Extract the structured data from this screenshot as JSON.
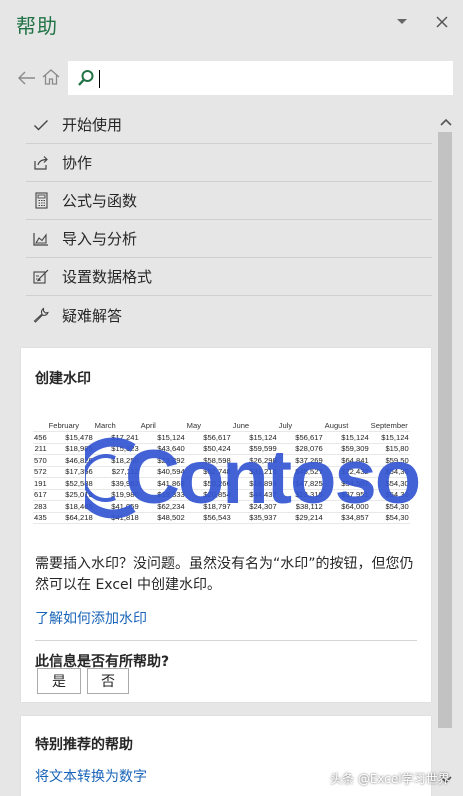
{
  "header": {
    "title": "帮助",
    "dropdown_icon": "chevron-down-icon",
    "close_icon": "close-icon"
  },
  "search": {
    "value": "",
    "placeholder": ""
  },
  "topics": [
    {
      "label": "开始使用",
      "icon": "checkmark-icon"
    },
    {
      "label": "协作",
      "icon": "share-icon"
    },
    {
      "label": "公式与函数",
      "icon": "calculator-icon"
    },
    {
      "label": "导入与分析",
      "icon": "chart-area-icon"
    },
    {
      "label": "设置数据格式",
      "icon": "format-edit-icon"
    },
    {
      "label": "疑难解答",
      "icon": "wrench-icon"
    }
  ],
  "watermark_card": {
    "title": "创建水印",
    "illustration": {
      "watermark_text": "Contoso",
      "watermark_color": "#3255d2",
      "columns": [
        "February",
        "March",
        "April",
        "May",
        "June",
        "July",
        "August",
        "September"
      ],
      "rows": [
        [
          "456",
          "$15,478",
          "$17,241",
          "$15,124",
          "$56,617",
          "$15,124",
          "$56,617",
          "$15,124",
          "$15,124"
        ],
        [
          "211",
          "$18,985",
          "$15,323",
          "$43,640",
          "$50,424",
          "$59,599",
          "$28,076",
          "$59,309",
          "$15,80"
        ],
        [
          "570",
          "$46,826",
          "$18,250",
          "$23,892",
          "$58,598",
          "$26,298",
          "$37,269",
          "$64,841",
          "$59,50"
        ],
        [
          "572",
          "$17,356",
          "$27,112",
          "$40,594",
          "$52,748",
          "$31,216",
          "$45,527",
          "$22,432",
          "$54,30"
        ],
        [
          "191",
          "$52,588",
          "$39,962",
          "$41,868",
          "$50,266",
          "$16,893",
          "$47,825",
          "$54,507",
          "$54,30"
        ],
        [
          "617",
          "$25,016",
          "$19,980",
          "$19,333",
          "$20,854",
          "$44,437",
          "$23,310",
          "$37,951",
          "$54,30"
        ],
        [
          "283",
          "$18,465",
          "$41,059",
          "$62,234",
          "$18,797",
          "$24,307",
          "$38,112",
          "$64,000",
          "$54,30"
        ],
        [
          "435",
          "$64,218",
          "$41,818",
          "$48,502",
          "$56,543",
          "$35,937",
          "$29,214",
          "$34,857",
          "$54,30"
        ]
      ]
    },
    "description": "需要插入水印？没问题。虽然没有名为“水印”的按钮，但您仍然可以在 Excel 中创建水印。",
    "link": "了解如何添加水印",
    "feedback_question": "此信息是否有所帮助?",
    "yes_label": "是",
    "no_label": "否"
  },
  "featured_card": {
    "title": "特别推荐的帮助",
    "link": "将文本转换为数字"
  },
  "credit": "头条 @Excel学习世界"
}
